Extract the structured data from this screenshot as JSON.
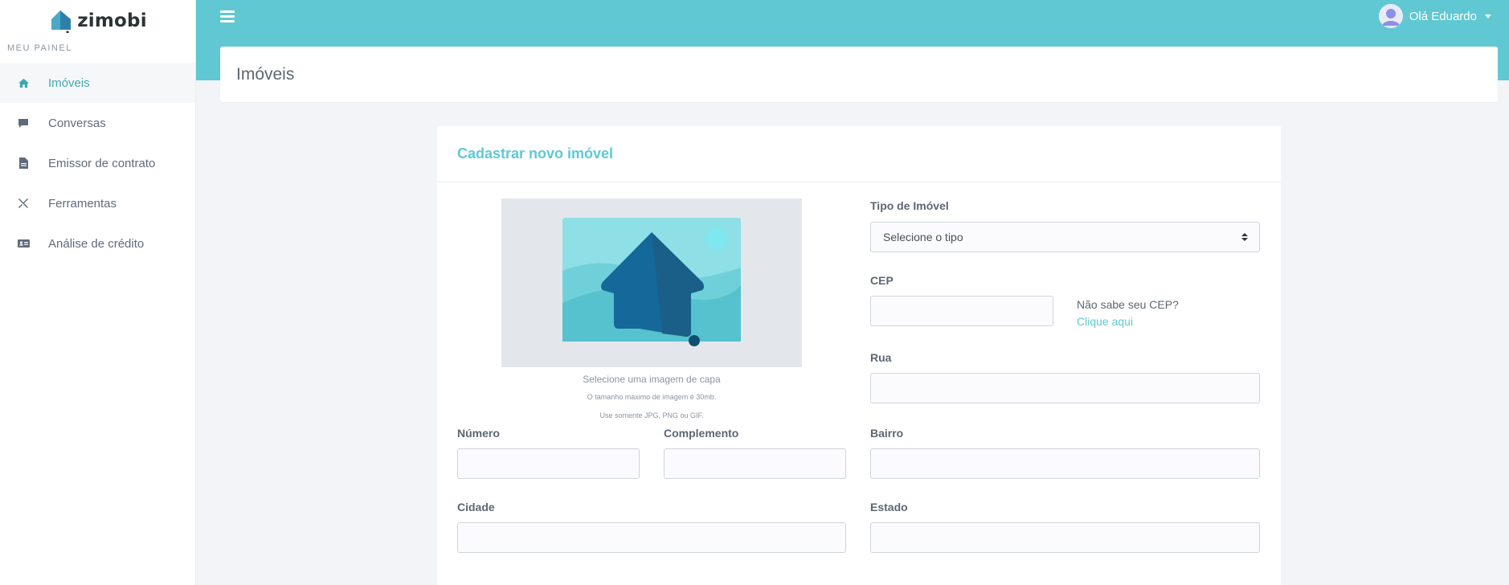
{
  "sidebar": {
    "logo_text": "zimobi",
    "section_label": "MEU PAINEL",
    "items": [
      {
        "label": "Imóveis",
        "icon": "home-icon",
        "active": true
      },
      {
        "label": "Conversas",
        "icon": "chat-icon",
        "active": false
      },
      {
        "label": "Emissor de contrato",
        "icon": "document-icon",
        "active": false
      },
      {
        "label": "Ferramentas",
        "icon": "tools-icon",
        "active": false
      },
      {
        "label": "Análise de crédito",
        "icon": "id-card-icon",
        "active": false
      }
    ]
  },
  "topbar": {
    "user_greeting": "Olá Eduardo"
  },
  "page": {
    "title": "Imóveis"
  },
  "form": {
    "title": "Cadastrar novo imóvel",
    "image": {
      "caption": "Selecione uma imagem de capa",
      "max_size_note": "O tamanho máximo de imagem é 30mb.",
      "formats_note": "Use somente JPG, PNG ou GIF."
    },
    "tipo": {
      "label": "Tipo de Imóvel",
      "selected": "Selecione o tipo"
    },
    "cep": {
      "label": "CEP",
      "value": "",
      "help_text": "Não sabe seu CEP?",
      "help_link": "Clique aqui"
    },
    "rua": {
      "label": "Rua",
      "value": ""
    },
    "numero": {
      "label": "Número",
      "value": ""
    },
    "complemento": {
      "label": "Complemento",
      "value": ""
    },
    "bairro": {
      "label": "Bairro",
      "value": ""
    },
    "cidade": {
      "label": "Cidade",
      "value": ""
    },
    "estado": {
      "label": "Estado",
      "value": ""
    }
  },
  "colors": {
    "accent": "#5fc8d2",
    "active_nav": "#3fa7b2",
    "house_dark": "#1a6a92"
  }
}
